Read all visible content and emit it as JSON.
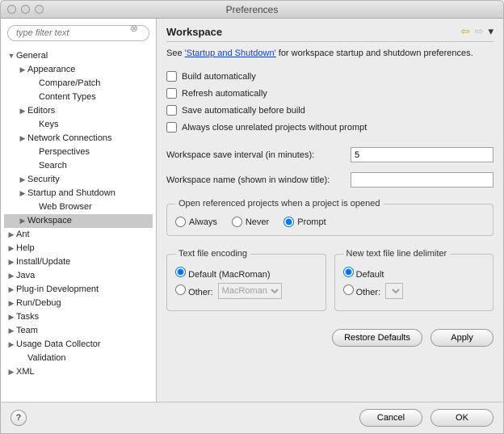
{
  "window": {
    "title": "Preferences"
  },
  "filter": {
    "placeholder": "type filter text"
  },
  "tree": {
    "general": "General",
    "appearance": "Appearance",
    "compare": "Compare/Patch",
    "contentTypes": "Content Types",
    "editors": "Editors",
    "keys": "Keys",
    "network": "Network Connections",
    "perspectives": "Perspectives",
    "search": "Search",
    "security": "Security",
    "startup": "Startup and Shutdown",
    "webBrowser": "Web Browser",
    "workspace": "Workspace",
    "ant": "Ant",
    "help": "Help",
    "install": "Install/Update",
    "java": "Java",
    "plugin": "Plug-in Development",
    "run": "Run/Debug",
    "tasks": "Tasks",
    "team": "Team",
    "usage": "Usage Data Collector",
    "validation": "Validation",
    "xml": "XML"
  },
  "page": {
    "title": "Workspace",
    "descPrefix": "See ",
    "descLink": "'Startup and Shutdown'",
    "descSuffix": " for workspace startup and shutdown preferences.",
    "buildAuto": "Build automatically",
    "refreshAuto": "Refresh automatically",
    "saveBefore": "Save automatically before build",
    "closeUnrelated": "Always close unrelated projects without prompt",
    "saveIntervalLabel": "Workspace save interval (in minutes):",
    "saveIntervalValue": "5",
    "wsNameLabel": "Workspace name (shown in window title):",
    "wsNameValue": "",
    "openRefLegend": "Open referenced projects when a project is opened",
    "always": "Always",
    "never": "Never",
    "prompt": "Prompt",
    "encLegend": "Text file encoding",
    "encDefault": "Default (MacRoman)",
    "encOther": "Other:",
    "encOtherValue": "MacRoman",
    "delimLegend": "New text file line delimiter",
    "delimDefault": "Default",
    "delimOther": "Other:",
    "restore": "Restore Defaults",
    "apply": "Apply",
    "cancel": "Cancel",
    "ok": "OK"
  }
}
